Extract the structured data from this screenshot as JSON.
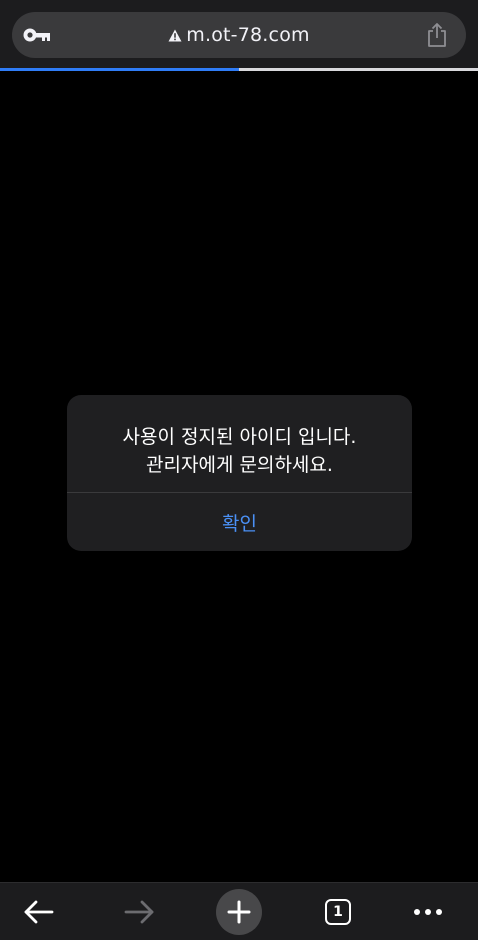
{
  "browser": {
    "url": "m.ot-78.com",
    "tab_count": "1",
    "page_load_progress": 0.5
  },
  "dialog": {
    "message_line1": "사용이 정지된 아이디 입니다.",
    "message_line2": "관리자에게 문의하세요.",
    "confirm_label": "확인"
  },
  "icons": {
    "key": "key-icon",
    "warning": "warning-icon",
    "share": "share-icon",
    "back": "back-arrow-icon",
    "forward": "forward-arrow-icon",
    "new_tab": "plus-icon",
    "tabs": "tab-switcher-icon",
    "menu": "more-dots-icon"
  },
  "colors": {
    "accent": "#4a90f5",
    "progress": "#2f7cf6",
    "background": "#000000",
    "dialog_bg": "#1f1f21"
  }
}
